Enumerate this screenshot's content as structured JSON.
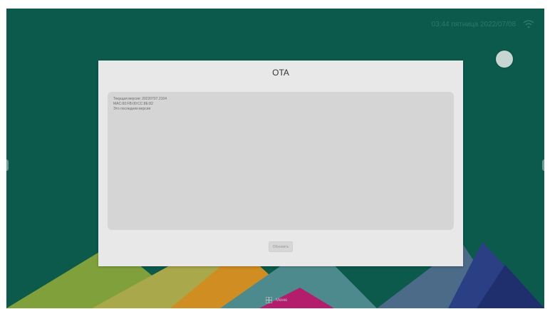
{
  "status_bar": {
    "clock": "03:44 пятница 2022/07/08",
    "wifi_icon": "wifi-icon"
  },
  "dialog": {
    "title": "OTA",
    "info_lines": [
      "Текущая версия: 20220707.2104",
      "MAC:60:FB:00:CC:8E:82",
      "Это последняя версия"
    ],
    "update_button_label": "Обновить"
  },
  "taskbar": {
    "menu_label": "Меню",
    "menu_icon": "grid-icon"
  },
  "colors": {
    "background": "#0b5a4b",
    "dialog": "#e8e8e8",
    "info_box": "#d5d5d5"
  }
}
